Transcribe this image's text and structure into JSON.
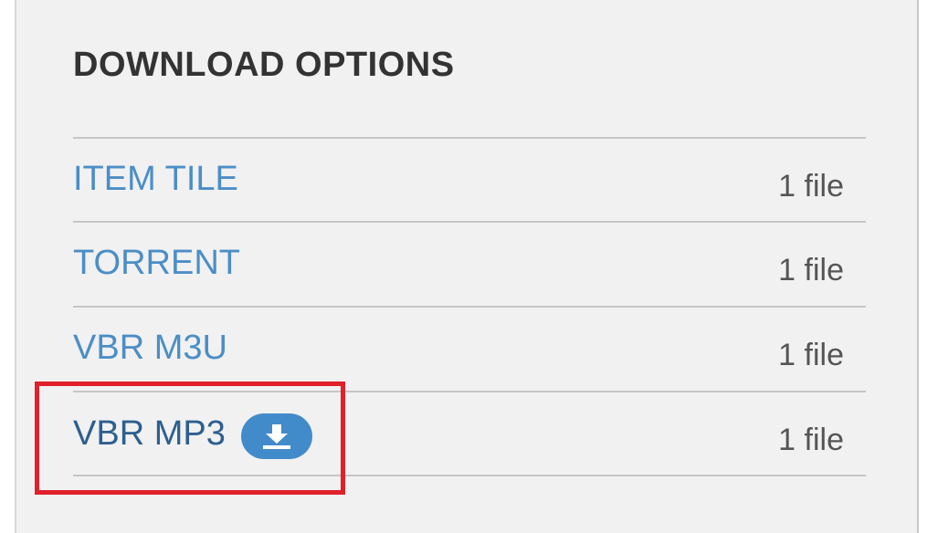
{
  "section": {
    "title": "DOWNLOAD OPTIONS"
  },
  "rows": [
    {
      "label": "ITEM TILE",
      "count": "1 file"
    },
    {
      "label": "TORRENT",
      "count": "1 file"
    },
    {
      "label": "VBR M3U",
      "count": "1 file"
    },
    {
      "label": "VBR MP3",
      "count": "1 file",
      "action_icon": "download-icon"
    }
  ],
  "colors": {
    "link": "#4b8ec6",
    "link_visited": "#2d5f8f",
    "pill": "#428bca",
    "highlight": "#e0202a"
  }
}
